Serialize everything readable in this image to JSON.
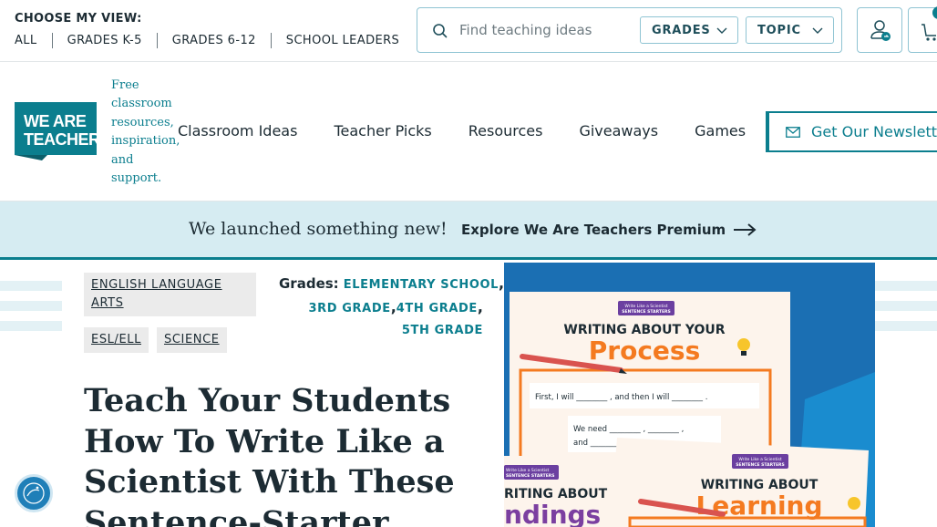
{
  "view_selector": {
    "label": "CHOOSE MY VIEW:",
    "links": [
      "ALL",
      "GRADES K-5",
      "GRADES 6-12",
      "SCHOOL LEADERS"
    ]
  },
  "search": {
    "placeholder": "Find teaching ideas",
    "grades_label": "GRADES",
    "topic_label": "TOPIC"
  },
  "site": {
    "logo_text_line1": "WE ARE",
    "logo_text_line2": "TEACHERS",
    "tagline": "Free classroom resources, inspiration, and support."
  },
  "nav": {
    "items": [
      "Classroom Ideas",
      "Teacher Picks",
      "Resources",
      "Giveaways",
      "Games"
    ],
    "newsletter_label": "Get Our Newsletter"
  },
  "promo": {
    "text": "We launched something new!",
    "link_label": "Explore We Are Teachers Premium"
  },
  "article": {
    "subjects": [
      "ENGLISH LANGUAGE ARTS",
      "ESL/ELL",
      "SCIENCE"
    ],
    "grades_label": "Grades:",
    "grades": [
      "ELEMENTARY SCHOOL",
      "3RD GRADE",
      "4TH GRADE",
      "5TH GRADE"
    ],
    "title": "Teach Your Students How To Write Like a Scientist With These Sentence-Starter"
  },
  "hero_image": {
    "worksheet1_badge_line1": "Write Like a Scientist",
    "worksheet1_badge_line2": "SENTENCE STARTERS",
    "worksheet1_title_line1": "WRITING ABOUT YOUR",
    "worksheet1_title_line2": "Process",
    "worksheet1_line1": "First, I will ________ , and then I will ________ .",
    "worksheet1_line2": "We need ________ , ________ ,",
    "worksheet1_line3": "and ________",
    "worksheet2_badge_line1": "Write Like a Scientist",
    "worksheet2_badge_line2": "SENTENCE STARTERS",
    "worksheet2_title_line1": "RITING ABOUT",
    "worksheet2_title_line2": "ndings",
    "worksheet3_badge_line1": "Write Like a Scientist",
    "worksheet3_badge_line2": "SENTENCE STARTERS",
    "worksheet3_title_line1": "WRITING ABOUT",
    "worksheet3_title_line2": "Learning"
  },
  "colors": {
    "brand_teal": "#0b7e8e",
    "banner_bg": "#d6ecf2",
    "hero_blue": "#1b6fb3",
    "orange": "#f47a20",
    "purple": "#7b3fa0"
  }
}
